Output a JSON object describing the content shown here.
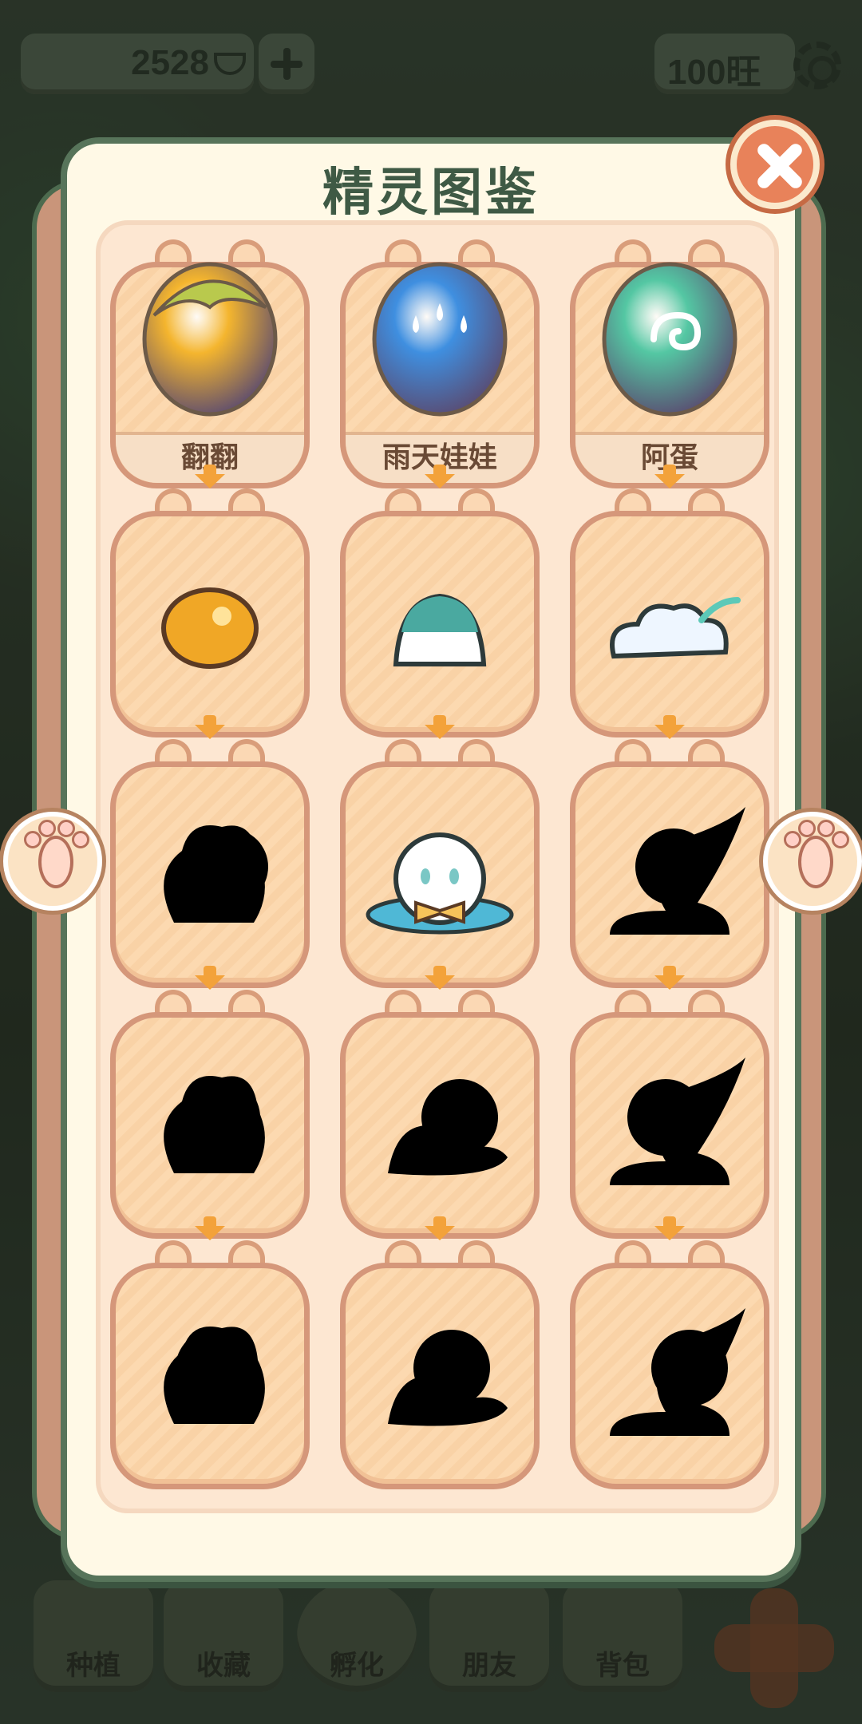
{
  "hud": {
    "coins": "2528",
    "wang": "100旺"
  },
  "book": {
    "title": "精灵图鉴"
  },
  "eggs": [
    {
      "name": "翻翻",
      "icon": "yellow-leaf-egg-icon",
      "color": "#f4b52e"
    },
    {
      "name": "雨天娃娃",
      "icon": "blue-raindrop-egg-icon",
      "color": "#3f8fe0"
    },
    {
      "name": "阿蛋",
      "icon": "green-swirl-egg-icon",
      "color": "#54c7a3"
    }
  ],
  "stages": [
    {
      "icon": "golden-orb-icon",
      "revealed": true
    },
    {
      "icon": "jelly-pudding-icon",
      "revealed": true
    },
    {
      "icon": "cloud-puff-icon",
      "revealed": true
    },
    {
      "icon": "creature-silhouette-icon",
      "revealed": false
    },
    {
      "icon": "ghost-with-bowtie-icon",
      "revealed": true
    },
    {
      "icon": "creature-silhouette-icon",
      "revealed": false
    },
    {
      "icon": "creature-silhouette-icon",
      "revealed": false
    },
    {
      "icon": "creature-silhouette-icon",
      "revealed": false
    },
    {
      "icon": "creature-silhouette-icon",
      "revealed": false
    },
    {
      "icon": "creature-silhouette-icon",
      "revealed": false
    },
    {
      "icon": "creature-silhouette-icon",
      "revealed": false
    },
    {
      "icon": "creature-silhouette-icon",
      "revealed": false
    }
  ],
  "nav": {
    "items": [
      {
        "label": "种植"
      },
      {
        "label": "收藏"
      },
      {
        "label": "孵化"
      },
      {
        "label": "朋友"
      },
      {
        "label": "背包"
      }
    ]
  }
}
